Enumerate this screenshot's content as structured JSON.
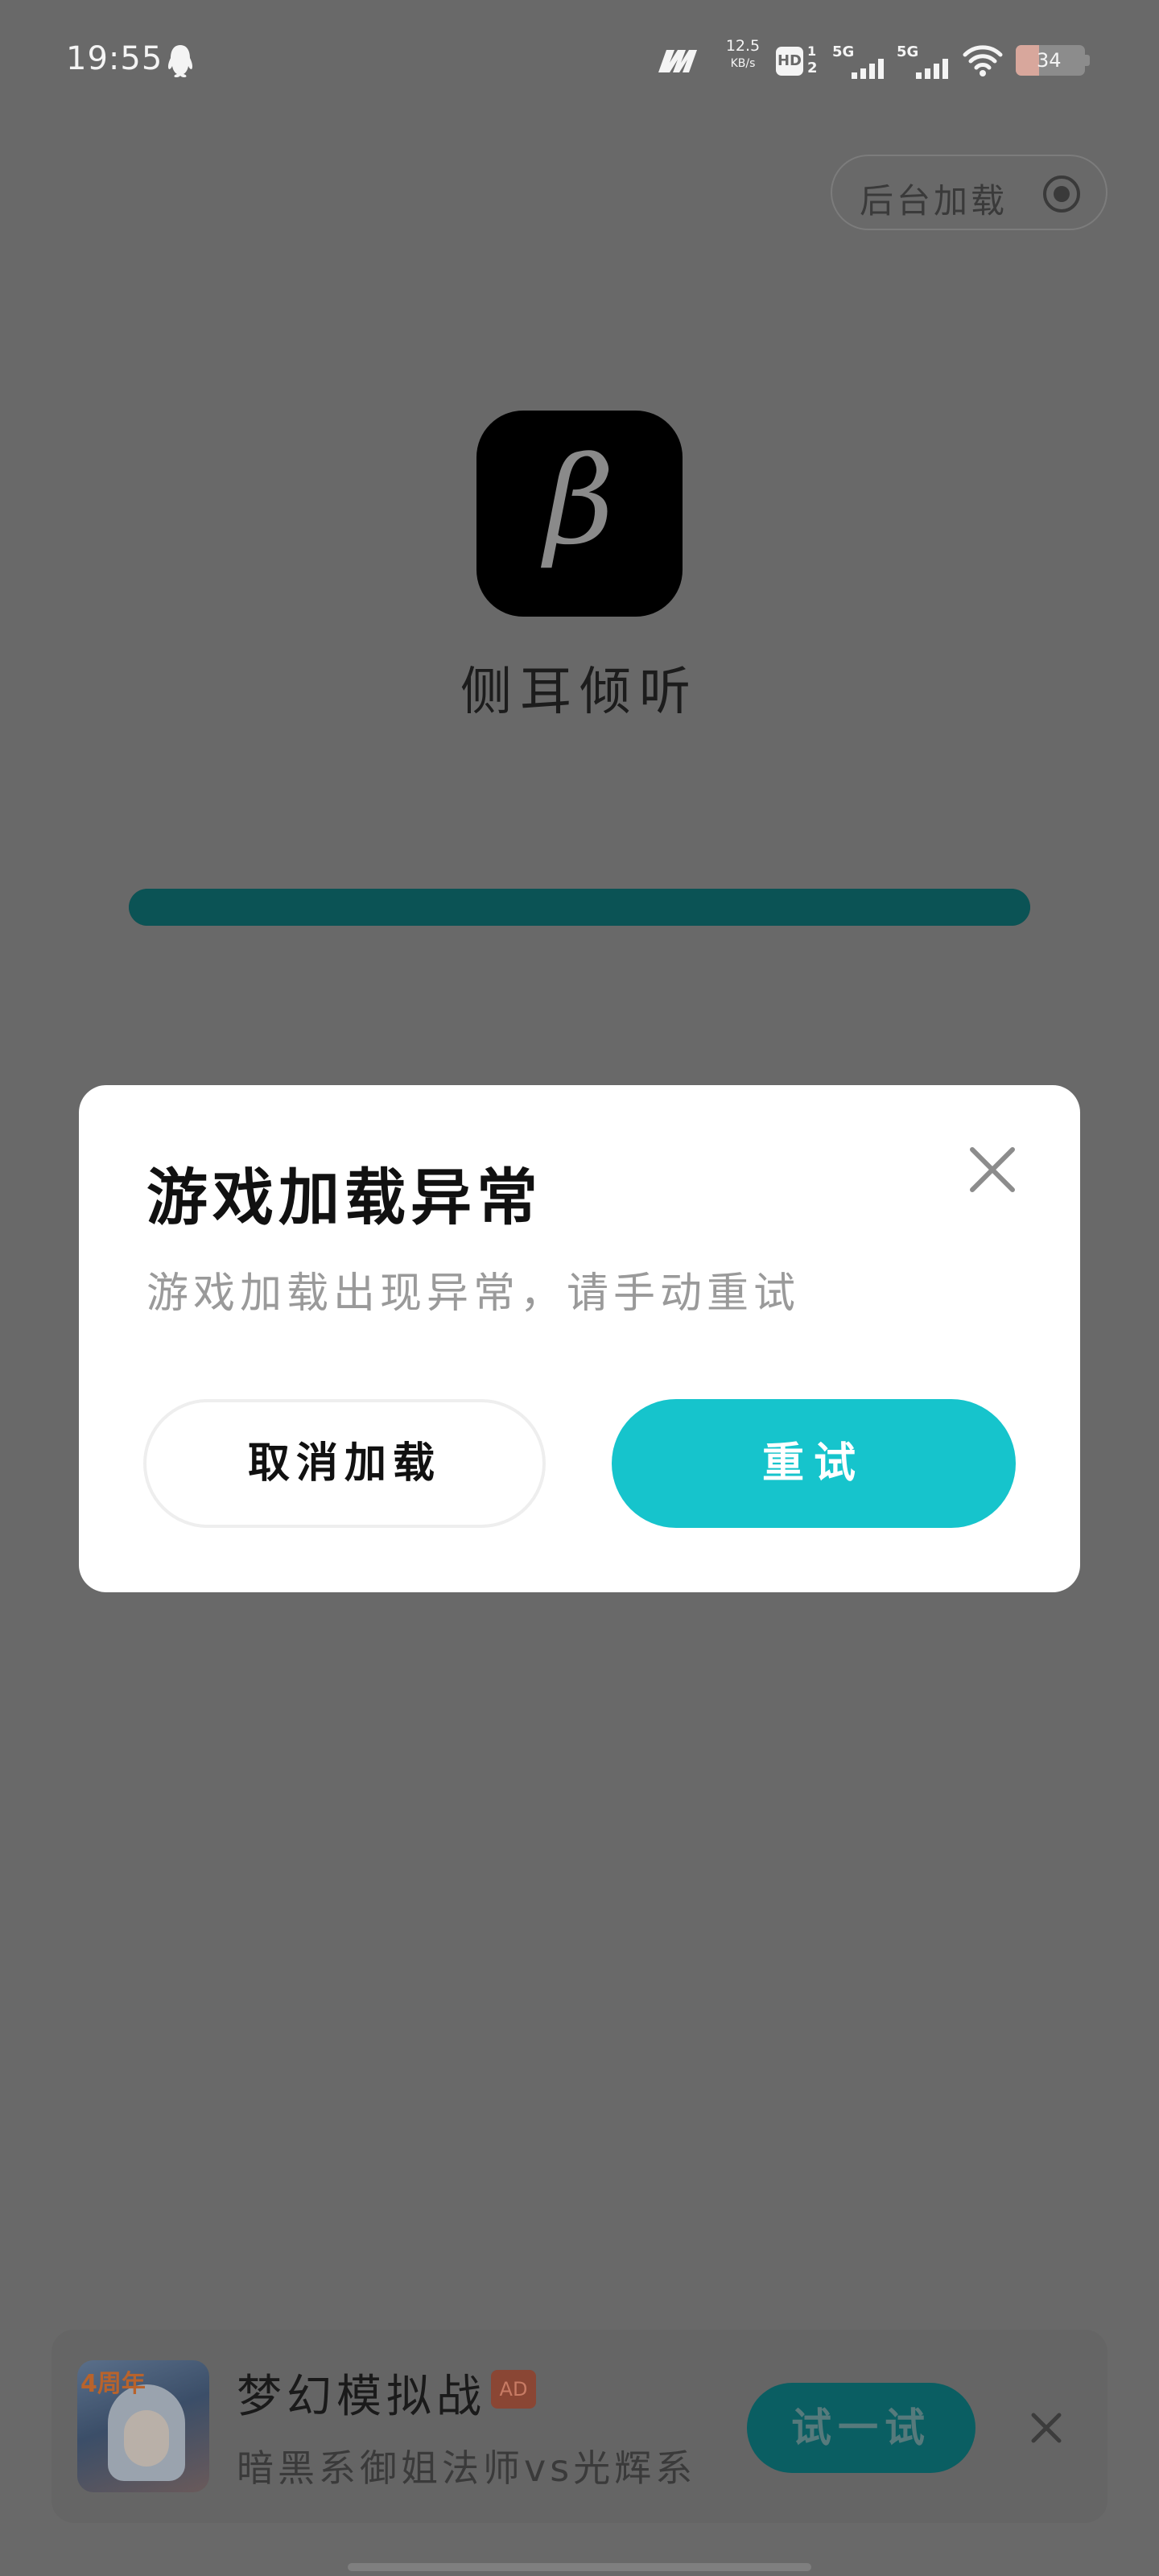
{
  "status_bar": {
    "time": "19:55",
    "net_speed_value": "12.5",
    "net_speed_unit": "KB/s",
    "hd_label": "HD",
    "hd_sim1": "1",
    "hd_sim2": "2",
    "sim1_network": "5G",
    "sim2_network": "5G",
    "battery_level": "34",
    "icons": [
      "qq-icon",
      "network-icon",
      "signal-icon",
      "wifi-icon",
      "battery-icon"
    ]
  },
  "loading_screen": {
    "background_load_label": "后台加载",
    "app_icon_glyph": "β",
    "app_name": "侧耳倾听",
    "progress_fraction": 1.0
  },
  "dialog": {
    "title": "游戏加载异常",
    "message": "游戏加载出现异常，请手动重试",
    "cancel_label": "取消加载",
    "retry_label": "重试",
    "accent_color": "#16c4cc"
  },
  "ad": {
    "thumb_badge": "4周年",
    "title": "梦幻模拟战",
    "badge": "AD",
    "description": "暗黑系御姐法师vs光辉系",
    "cta_label": "试一试"
  }
}
